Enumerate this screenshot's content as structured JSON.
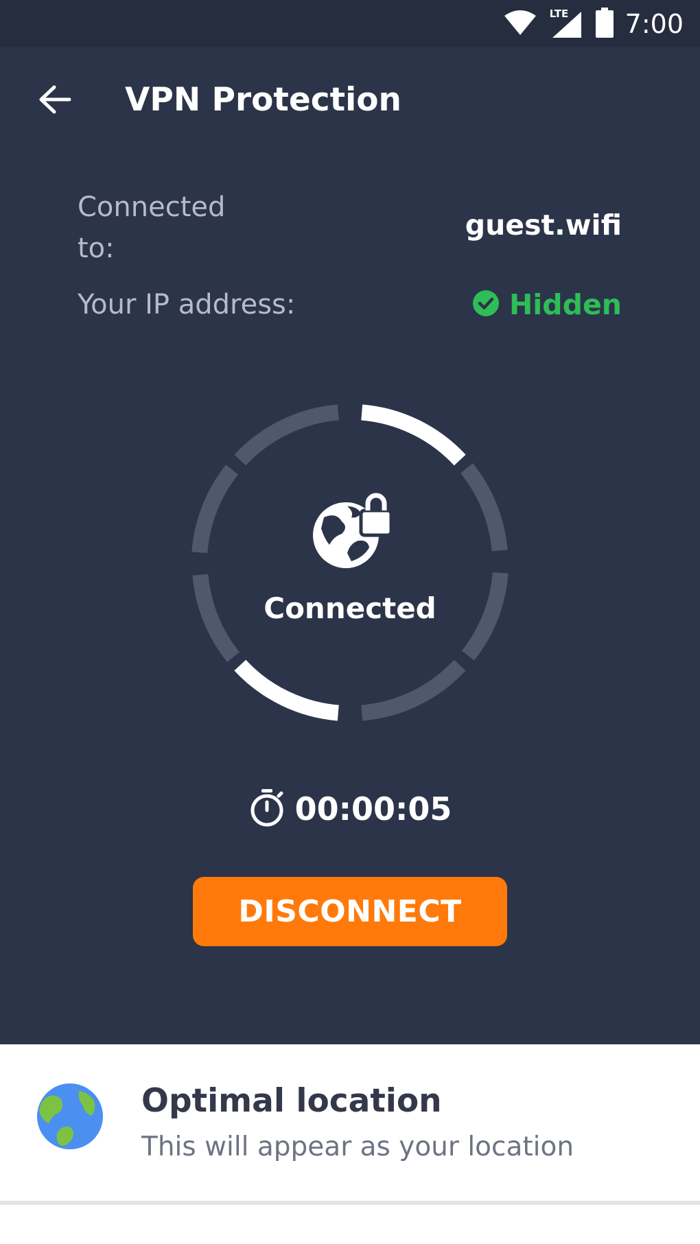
{
  "status_bar": {
    "time": "7:00",
    "icons": [
      "wifi-icon",
      "lte-signal-icon",
      "battery-icon"
    ],
    "network_type": "LTE"
  },
  "header": {
    "title": "VPN Protection",
    "back_icon": "arrow-left-icon"
  },
  "info": {
    "connected_label": "Connected to:",
    "network_name": "guest.wifi",
    "ip_label": "Your IP address:",
    "ip_status": "Hidden",
    "ip_status_icon": "check-circle-icon"
  },
  "ring": {
    "status_label": "Connected",
    "center_icon": "globe-lock-icon"
  },
  "timer": {
    "icon": "stopwatch-icon",
    "value": "00:00:05"
  },
  "actions": {
    "disconnect_label": "DISCONNECT"
  },
  "location": {
    "icon": "globe-icon",
    "title": "Optimal location",
    "subtitle": "This will appear as your location"
  },
  "colors": {
    "background": "#2c3449",
    "status_bar": "#262d3f",
    "accent_orange": "#ff7a0b",
    "success_green": "#2dbe57",
    "ring_active": "#ffffff",
    "ring_inactive": "#4f586d",
    "card_background": "#ffffff"
  }
}
